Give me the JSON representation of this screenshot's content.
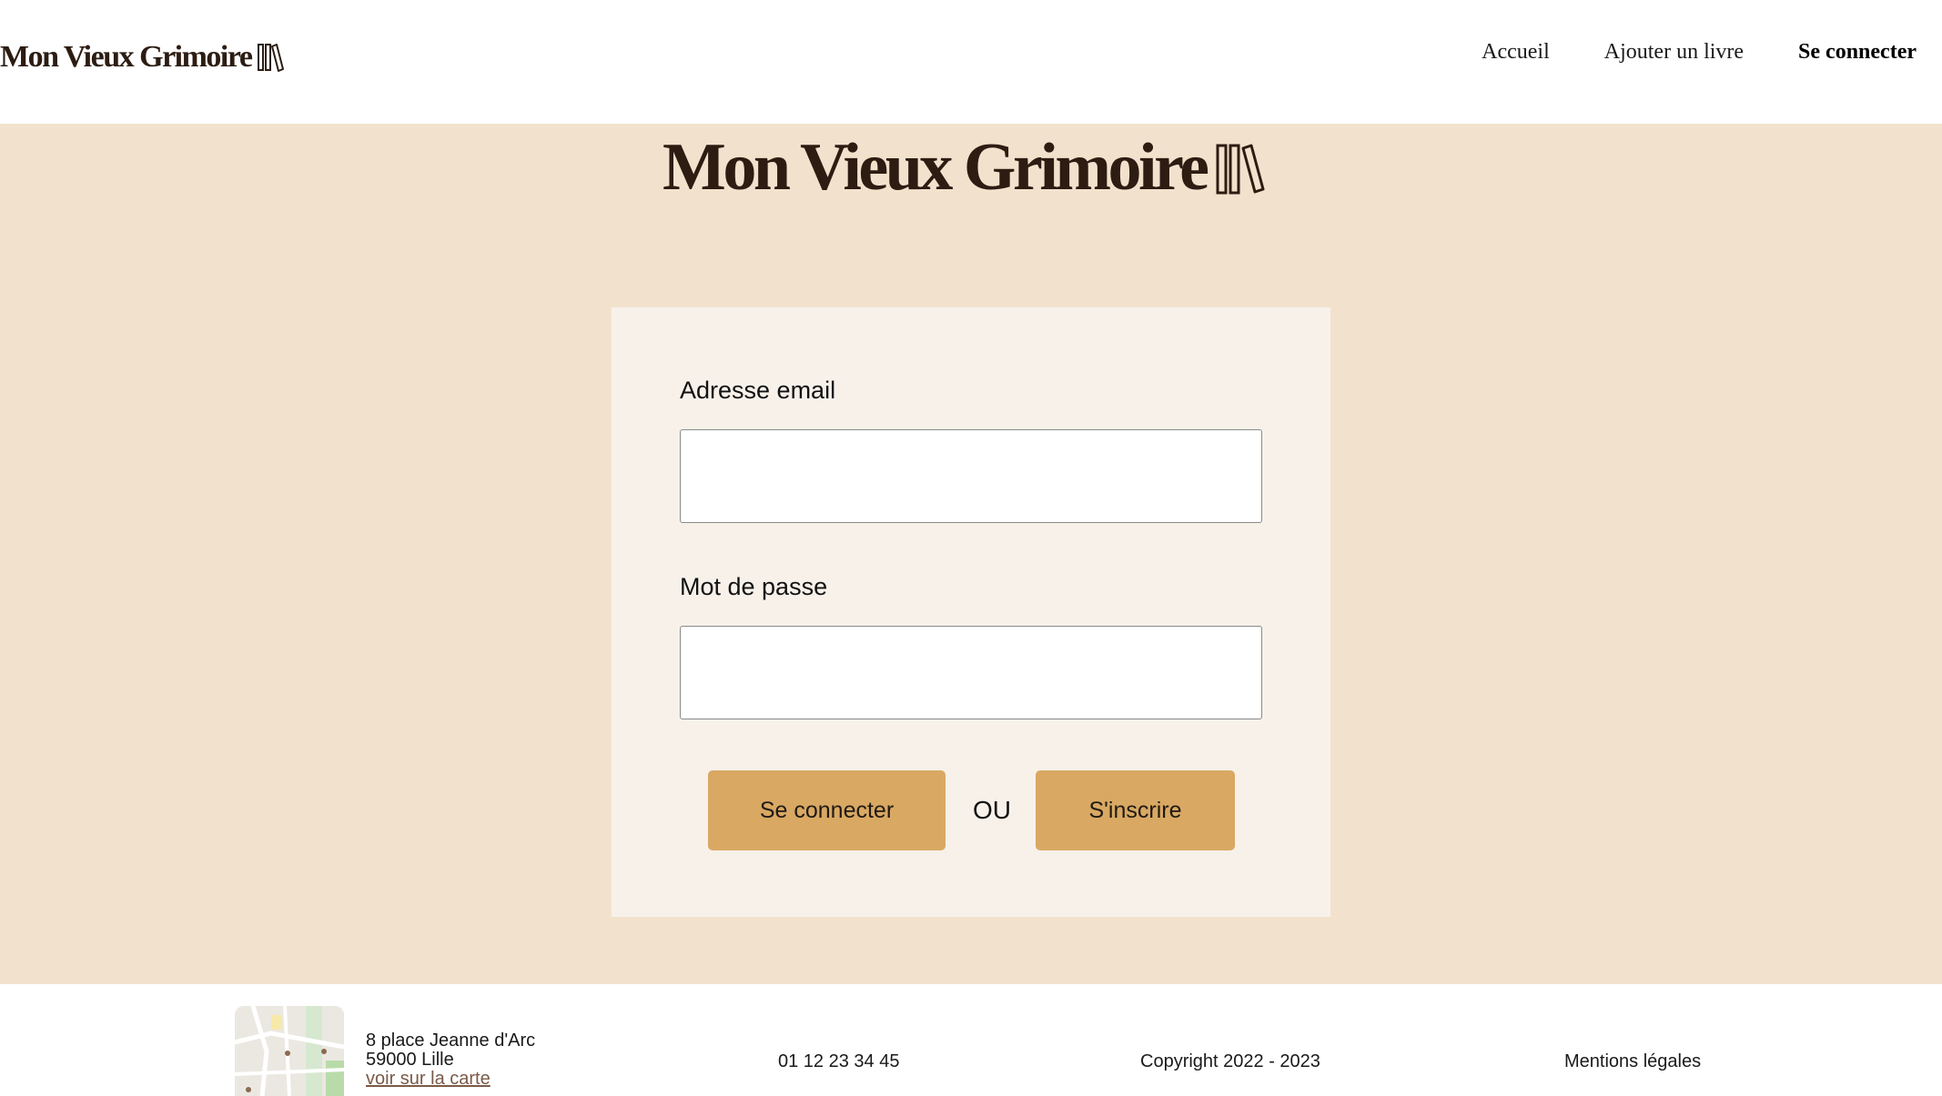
{
  "header": {
    "logo_text": "Mon Vieux Grimoire",
    "nav": {
      "home": "Accueil",
      "add_book": "Ajouter un livre",
      "login": "Se connecter"
    }
  },
  "main": {
    "logo_text": "Mon Vieux Grimoire",
    "form": {
      "email_label": "Adresse email",
      "email_value": "",
      "password_label": "Mot de passe",
      "password_value": "",
      "login_button": "Se connecter",
      "or_text": "OU",
      "signup_button": "S'inscrire"
    }
  },
  "footer": {
    "address_line1": "8 place Jeanne d'Arc",
    "address_line2": "59000 Lille",
    "map_link": "voir sur la carte",
    "phone": "01 12 23 34 45",
    "copyright": "Copyright 2022 - 2023",
    "legal": "Mentions légales"
  },
  "colors": {
    "brand_dark": "#2c1c12",
    "main_background": "#f2e2cd",
    "card_background": "#f7f1ea",
    "button_accent": "#d9a863"
  },
  "icons": [
    "books-logo-icon",
    "map-thumbnail-icon"
  ]
}
